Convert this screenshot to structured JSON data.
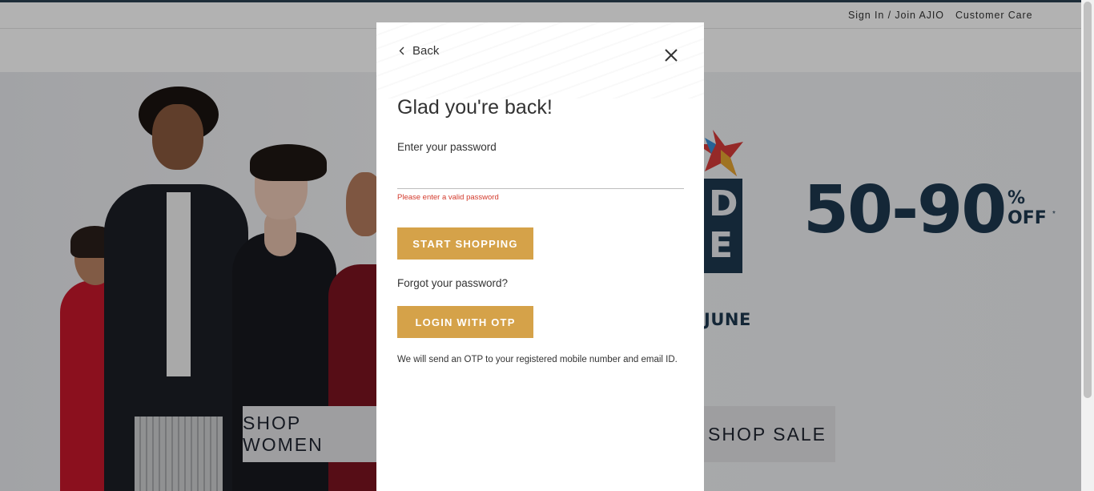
{
  "header": {
    "sign_in": "Sign In / Join AJIO",
    "customer_care": "Customer Care"
  },
  "hero": {
    "shop_women": "SHOP WOMEN",
    "shop_sale": "SHOP SALE",
    "promo_number": "50-90",
    "promo_percent": "%",
    "promo_off": "OFF",
    "promo_asterisk": "*",
    "promo_date_fragment": "JUNE",
    "logo_letters_top": "D",
    "logo_letters_bottom": "E"
  },
  "modal": {
    "back_label": "Back",
    "title": "Glad you're back!",
    "password_label": "Enter your password",
    "password_value": "",
    "password_error": "Please enter a valid password",
    "start_shopping_label": "START SHOPPING",
    "forgot_label": "Forgot your password?",
    "otp_button_label": "LOGIN WITH OTP",
    "otp_note": "We will send an OTP to your registered mobile number and email ID."
  },
  "colors": {
    "accent_gold": "#d5a249",
    "error_red": "#d33a2c",
    "promo_navy": "#1d3850",
    "overlay": "rgba(0,0,0,0.30)"
  }
}
